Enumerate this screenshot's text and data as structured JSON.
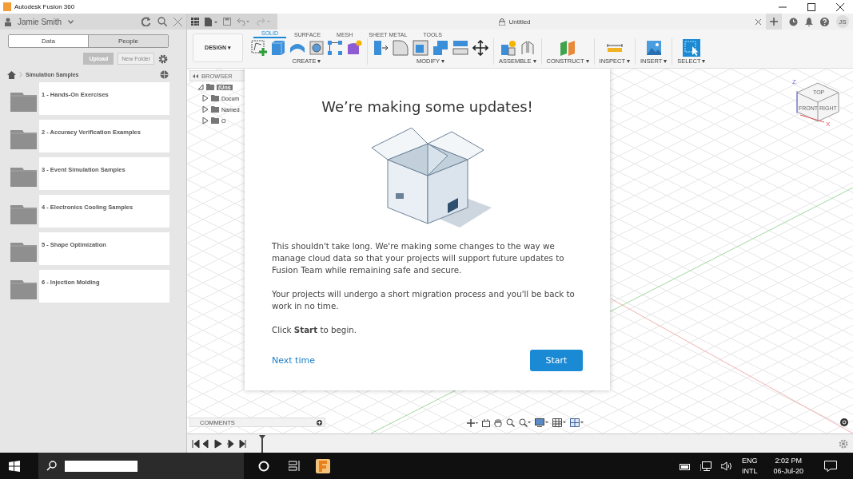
{
  "window": {
    "title": "Autodesk Fusion 360"
  },
  "data_panel": {
    "user": "Jamie Smith",
    "tabs": [
      {
        "label": "Data",
        "selected": true
      },
      {
        "label": "People",
        "selected": false
      }
    ],
    "upload": "Upload",
    "new_folder": "New Folder",
    "breadcrumb": "Simulation Samples",
    "folders": [
      "1 - Hands-On Exercises",
      "2 - Accuracy Verification Examples",
      "3 - Event Simulation Samples",
      "4 - Electronics Cooling Samples",
      "5 - Shape Optimization",
      "6 - Injection Molding"
    ]
  },
  "document_tab": {
    "title": "Untitled"
  },
  "user_initials": "JS",
  "workspace": "DESIGN ▾",
  "ribbon_tabs": [
    {
      "label": "SOLID",
      "selected": true
    },
    {
      "label": "SURFACE",
      "selected": false
    },
    {
      "label": "MESH",
      "selected": false
    },
    {
      "label": "SHEET METAL",
      "selected": false
    },
    {
      "label": "TOOLS",
      "selected": false
    }
  ],
  "ribbon_groups": [
    "CREATE ▾",
    "MODIFY ▾",
    "ASSEMBLE ▾",
    "CONSTRUCT ▾",
    "INSPECT ▾",
    "INSERT ▾",
    "SELECT ▾"
  ],
  "browser": {
    "title": "BROWSER",
    "items": [
      "(Uns",
      "Docum",
      "Named",
      "O"
    ]
  },
  "view_cube": {
    "top": "TOP",
    "front": "FRONT",
    "right": "RIGHT",
    "z": "Z",
    "x": "X"
  },
  "dialog": {
    "title": "We’re making some updates!",
    "paragraphs": [
      "This shouldn't take long. We're making some changes to the way we manage cloud data so that your projects will support future updates to Fusion Team while remaining safe and secure.",
      "Your projects will undergo a short migration process and you'll be back to work in no time.",
      "Click **Start** to begin."
    ],
    "link": "Next time",
    "button": "Start"
  },
  "comments": "COMMENTS",
  "taskbar": {
    "language": "ENG",
    "layout": "INTL",
    "time": "2:02 PM",
    "date": "06-Jul-20"
  }
}
